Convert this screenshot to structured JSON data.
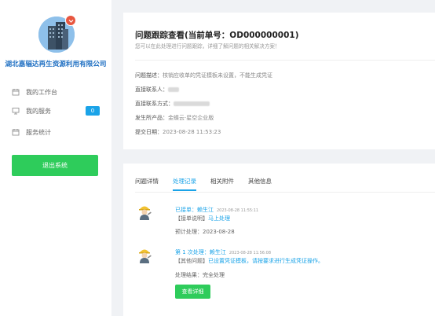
{
  "sidebar": {
    "company_name": "湖北嘉辐达再生资源利用有限公司",
    "menu": [
      {
        "label": "我的工作台",
        "icon": "calendar-icon"
      },
      {
        "label": "我的服务",
        "icon": "monitor-icon",
        "badge": "0"
      },
      {
        "label": "服务统计",
        "icon": "calendar-icon"
      }
    ],
    "logout_label": "退出系统"
  },
  "issue": {
    "title": "问题跟踪查看(当前单号：OD000000001)",
    "subtitle": "您可以在此处理进行问题跟踪，详细了解问题的相关解决方案！",
    "fields": [
      {
        "label": "问题描述：",
        "value": "核销应收单的凭证模板未设置，不能生成凭证"
      },
      {
        "label": "直接联系人：",
        "value": ""
      },
      {
        "label": "直接联系方式：",
        "value": ""
      },
      {
        "label": "发生所产品：",
        "value": "金蝶云·星空企业版"
      },
      {
        "label": "提交日期：",
        "value": "2023-08-28 11:53:23"
      }
    ]
  },
  "tabs": [
    "问题详情",
    "处理记录",
    "相关附件",
    "其他信息"
  ],
  "active_tab": "处理记录",
  "records": [
    {
      "head": "已接单：赖生江",
      "time": "2023-08-28 11:55:11",
      "line1_prefix": "【接单说明】",
      "line1_highlight": "马上处理",
      "line2": "预计处理：2023-08-28"
    },
    {
      "head": "第 1 次处理：赖生江",
      "time": "2023-08-28 11:56:08",
      "line1_prefix": "【其他问题】",
      "line1_highlight": "已设置凭证模板，请按要求进行生成凭证操作。",
      "line2": "处理结果：完全处理",
      "button": "查看详细"
    }
  ],
  "colors": {
    "accent": "#1aa3e8",
    "green": "#2ecc5b",
    "company": "#1d6ec2",
    "badge": "#e8563f"
  }
}
